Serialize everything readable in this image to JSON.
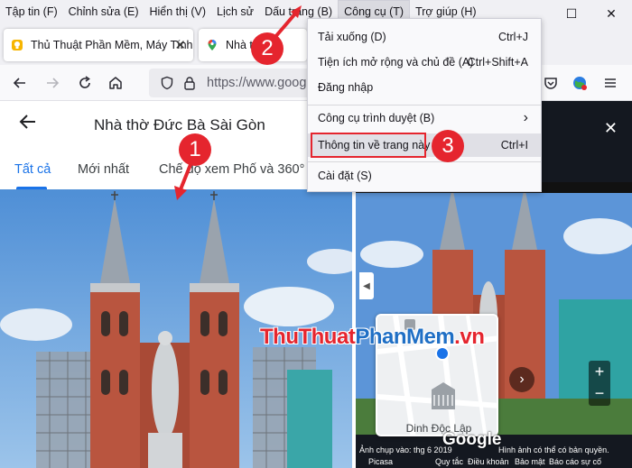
{
  "menubar": {
    "items": [
      "Tập tin (F)",
      "Chỉnh sửa (E)",
      "Hiển thị (V)",
      "Lịch sử",
      "Dấu trang (B)",
      "Công cụ (T)",
      "Trợ giúp (H)"
    ]
  },
  "window": {
    "minimize": "—",
    "maximize": "☐",
    "close": "✕"
  },
  "tabs": [
    {
      "title": "Thủ Thuật Phần Mềm, Máy Tính, ",
      "close": "✕"
    },
    {
      "title": "Nhà t",
      "close": ""
    }
  ],
  "nav": {
    "url": "https://www.googl"
  },
  "dropdown": {
    "items": [
      {
        "label": "Tải xuống (D)",
        "shortcut": "Ctrl+J"
      },
      {
        "label": "Tiện ích mở rộng và chủ đề (A)",
        "shortcut": "Ctrl+Shift+A"
      },
      {
        "label": "Đăng nhập",
        "shortcut": ""
      },
      {
        "label": "Công cụ trình duyệt (B)",
        "shortcut": "›"
      },
      {
        "label": "Thông tin về trang này",
        "shortcut": "Ctrl+I"
      },
      {
        "label": "Cài đặt (S)",
        "shortcut": ""
      }
    ]
  },
  "maps": {
    "title": "Nhà thờ Đức Bà Sài Gòn",
    "tabs": [
      "Tất cả",
      "Mới nhất",
      "Chế độ xem Phố và 360°"
    ],
    "map_label": "Dinh Độc Lập",
    "google": "Google",
    "photo_date": "Ảnh chụp vào: thg 6 2019",
    "picasa": "Picasa",
    "copyright": "Hình ảnh có thể có bản quyền.",
    "footer": [
      "Quy tắc",
      "Điều khoản",
      "Bảo mật",
      "Báo cáo sự cố"
    ]
  },
  "callouts": [
    "1",
    "2",
    "3"
  ],
  "watermark": {
    "part1": "ThuThuat",
    "part2": "PhanMem",
    "part3": ".vn"
  },
  "colors": {
    "accent": "#1a73e8",
    "callout": "#e5252e",
    "menu_bg": "#f0f0f4"
  }
}
